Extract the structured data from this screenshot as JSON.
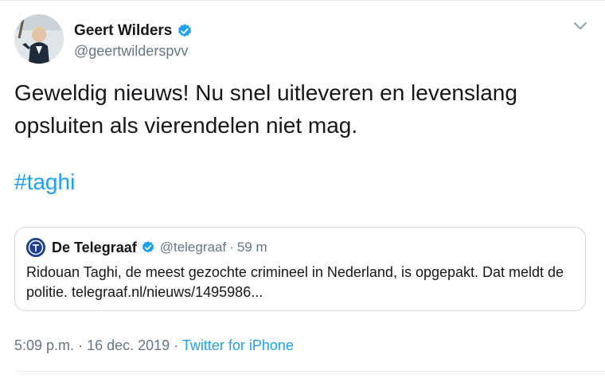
{
  "author": {
    "display_name": "Geert Wilders",
    "handle": "@geertwilderspvv",
    "verified": true
  },
  "tweet": {
    "text": "Geweldig nieuws! Nu snel uitleveren en levenslang opsluiten als vierendelen niet mag.",
    "hashtag": "#taghi"
  },
  "quoted_tweet": {
    "display_name": "De Telegraaf",
    "handle": "@telegraaf",
    "separator": "·",
    "time": "59 m",
    "text": "Ridouan Taghi, de meest gezochte crimineel in Nederland, is opgepakt. Dat meldt de politie. telegraaf.nl/nieuws/1495986..."
  },
  "meta": {
    "time": "5:09 p.m.",
    "sep1": "·",
    "date": "16 dec. 2019",
    "sep2": "·",
    "source": "Twitter for iPhone"
  },
  "colors": {
    "link": "#1da1f2",
    "verified": "#1da1f2",
    "secondary_text": "#657786",
    "border": "#ccd6dd"
  },
  "icons": {
    "verified": "verified-badge-icon",
    "menu": "chevron-down-icon"
  }
}
